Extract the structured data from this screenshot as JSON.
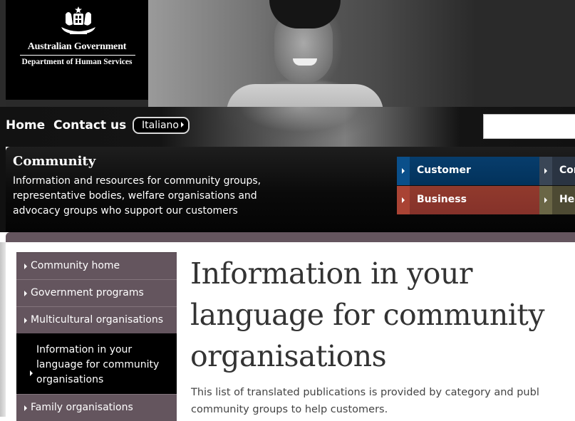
{
  "logo": {
    "icon": "coat-of-arms-icon",
    "title": "Australian Government",
    "subtitle": "Department of Human Services"
  },
  "nav": {
    "home": "Home",
    "contact": "Contact us",
    "language_button": "Italiano",
    "search": {
      "value": "",
      "placeholder": ""
    }
  },
  "section": {
    "title": "Community",
    "description": "Information and resources for community groups, representative bodies, welfare organisations and advocacy groups who support our customers"
  },
  "audience_tiles": [
    {
      "label": "Customer",
      "color": "#02325b",
      "icon": "arrow-right-icon"
    },
    {
      "label": "Business",
      "color": "#85322a",
      "icon": "arrow-right-icon"
    },
    {
      "label": "Community",
      "color": "#2a3442",
      "icon": "arrow-right-icon"
    },
    {
      "label": "Health",
      "color": "#4d4a33",
      "icon": "arrow-right-icon"
    }
  ],
  "sidebar": {
    "accent_color": "#64555e",
    "items": [
      {
        "label": "Community home",
        "active": false
      },
      {
        "label": "Government programs",
        "active": false
      },
      {
        "label": "Multicultural organisations",
        "active": false
      },
      {
        "label": "Information in your language for community organisations",
        "active": true
      },
      {
        "label": "Family organisations",
        "active": false
      }
    ]
  },
  "main": {
    "title": "Information in your language for community organisations",
    "intro": "This list of translated publications is provided by category and publ community groups to help customers."
  }
}
